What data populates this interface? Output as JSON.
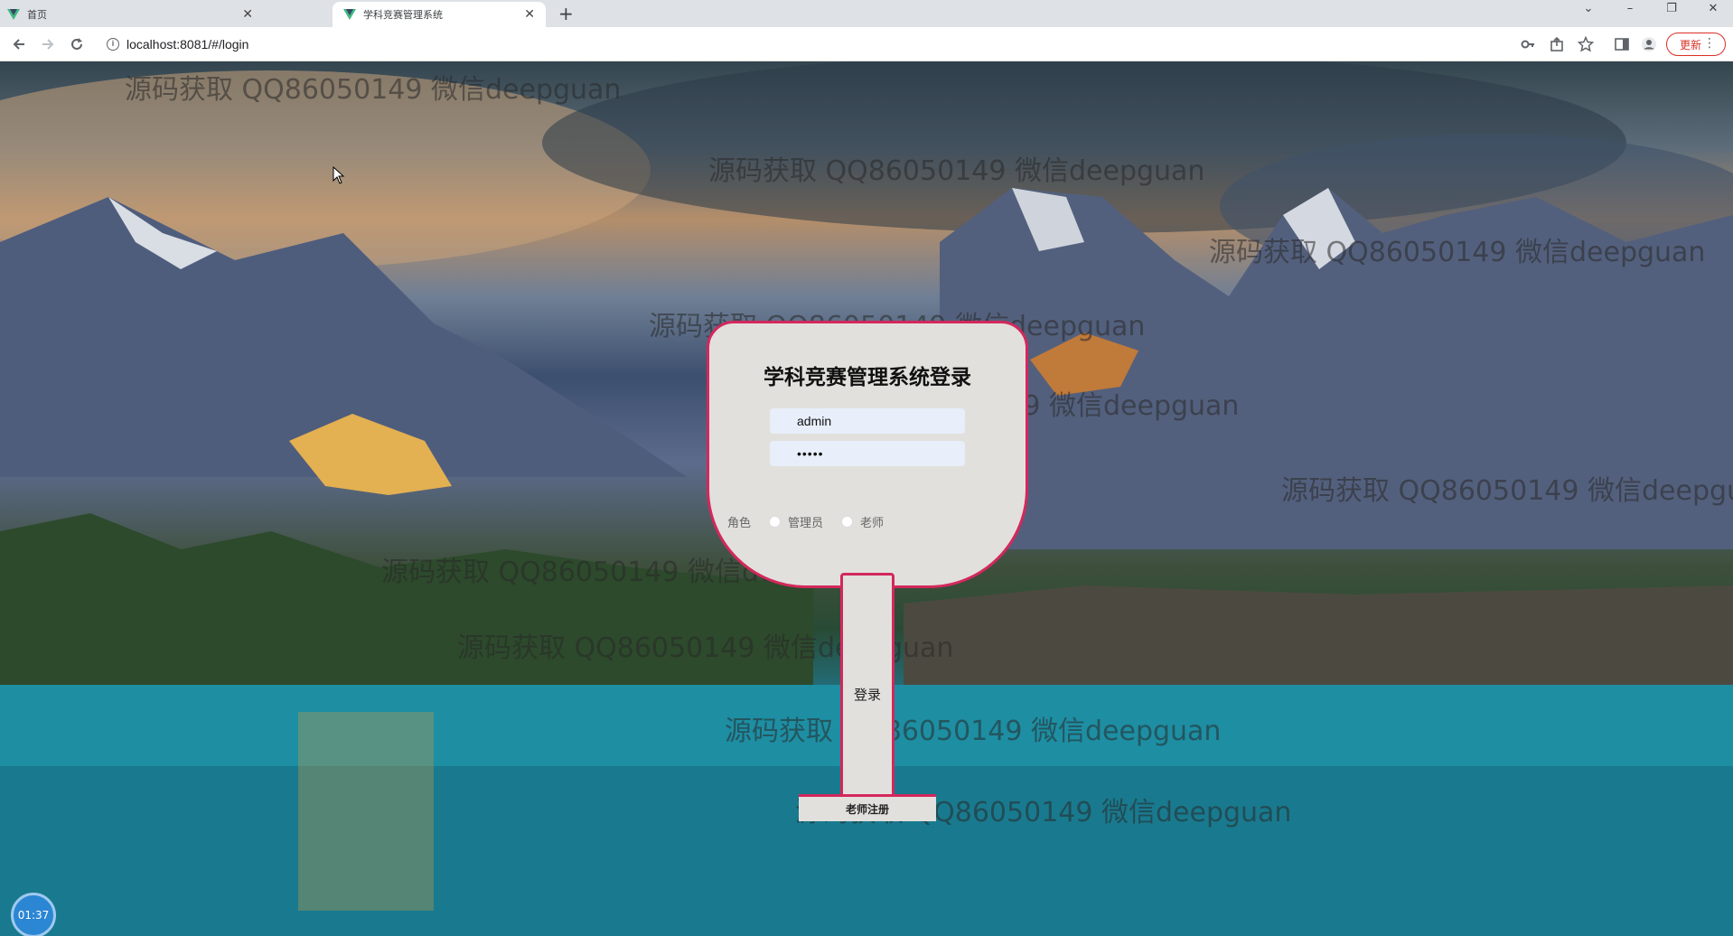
{
  "browser": {
    "tabs": [
      {
        "label": "首页"
      },
      {
        "label": "学科竞赛管理系统"
      }
    ],
    "new_tab": "+",
    "window_controls": {
      "dropdown": "⌄",
      "minimize": "–",
      "restore": "❐",
      "close": "✕"
    },
    "address": "localhost:8081/#/login",
    "update_label": "更新",
    "update_menu": "⋮"
  },
  "watermark_text": "源码获取 QQ86050149 微信deepguan",
  "login": {
    "title": "学科竞赛管理系统登录",
    "username_value": "admin",
    "password_value": "•••••",
    "role_label": "角色",
    "roles": [
      {
        "label": "管理员",
        "selected": false
      },
      {
        "label": "老师",
        "selected": false
      }
    ],
    "login_button": "登录",
    "register_button": "老师注册"
  },
  "clock": "01:37",
  "colors": {
    "accent": "#d3285c",
    "card_bg": "#e1e0dc",
    "input_bg": "#e8eefa"
  }
}
